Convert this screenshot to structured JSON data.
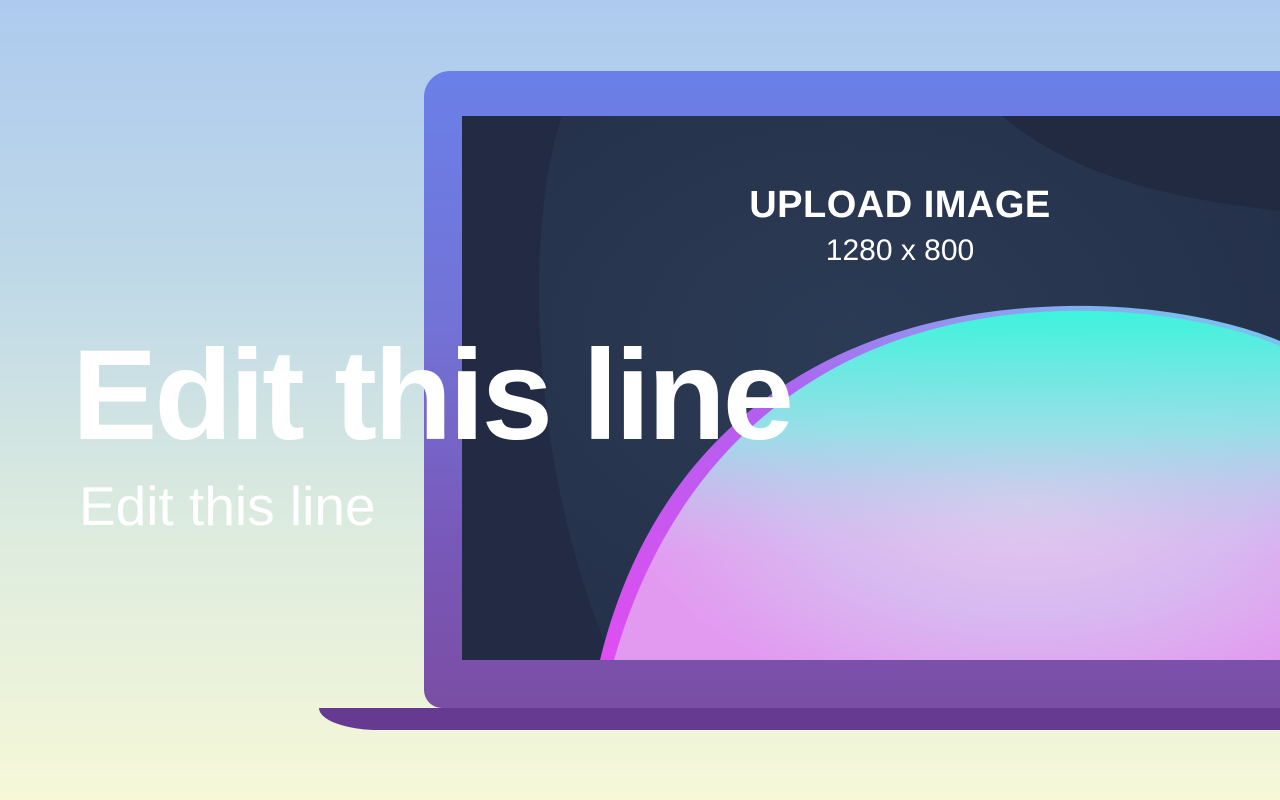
{
  "upload": {
    "title": "UPLOAD IMAGE",
    "size": "1280 x 800"
  },
  "hero": {
    "headline": "Edit this line",
    "subline": "Edit this line"
  },
  "colors": {
    "background_top": "#aecaee",
    "background_bottom": "#f6f8d8",
    "laptop_frame": "#6a80e8",
    "laptop_base": "#663a90",
    "screen": "#232b44",
    "sphere_cyan": "#3cf4dc",
    "sphere_magenta": "#e04ef0"
  }
}
